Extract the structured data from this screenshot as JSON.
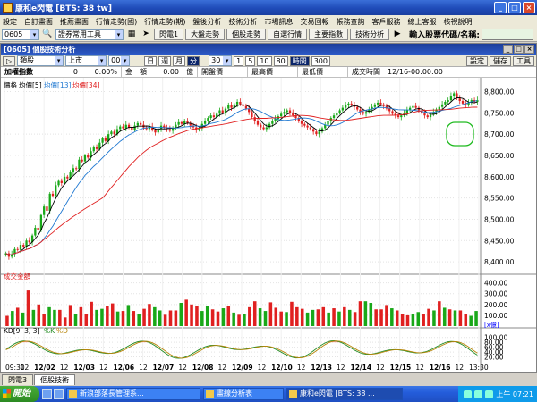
{
  "window": {
    "title": "康和e閃電 [BTS: 38 tw]",
    "buttons": [
      "_",
      "□",
      "×"
    ]
  },
  "menu": [
    "設定",
    "自訂畫面",
    "推薦畫面",
    "行情走勢(國)",
    "行情走勢(期)",
    "盤後分析",
    "技術分析",
    "市場訊息",
    "交易回報",
    "帳務查詢",
    "客戶服務",
    "線上客服",
    "核視說明"
  ],
  "toolbar": {
    "code_value": "0605",
    "tool_select": "證券常用工具",
    "buttons": [
      "閃電1",
      "大盤走勢",
      "個股走勢",
      "自選行情",
      "主要指數",
      "技術分析"
    ],
    "stock_label": "輸入股票代碼/名稱:"
  },
  "panel": {
    "title": "[0605] 個股技術分析",
    "controls": {
      "type": "類股",
      "market": "上市",
      "code": "001",
      "periods": [
        "日",
        "週",
        "月",
        "分"
      ],
      "minutes": "30",
      "ranges": [
        "1",
        "5",
        "10",
        "80",
        "時間",
        "300"
      ],
      "right_buttons": [
        "設定",
        "儲存",
        "工具"
      ]
    },
    "info": {
      "label": "加權指數",
      "price": "0",
      "change": "0.00%",
      "amount_label": "金　額",
      "amount": "0.00",
      "unit": "億",
      "open_label": "開盤價",
      "high_label": "最高價",
      "low_label": "最低價",
      "time_label": "成交時間",
      "time_value": "12/16-00:00:00"
    }
  },
  "price_legend": {
    "label": "價格",
    "ma5": "均價[5]",
    "ma13": "均價[13]",
    "ma34": "均價[34]"
  },
  "volume_legend": "成交金額",
  "volume_unit": "[x億]",
  "kd_legend": {
    "label": "KD[9, 3, 3]",
    "k": "%K",
    "d": "%D"
  },
  "tabs": [
    "閃電3",
    "個股技術"
  ],
  "taskbar": {
    "start": "開始",
    "items": [
      "新浪部落長管理系...",
      "畫線分析表",
      "康和e閃電 [BTS: 38 ..."
    ],
    "clock": "上午 07:21"
  },
  "colors": {
    "up": "#19a819",
    "down": "#e02020",
    "ma5": "#000000",
    "ma13": "#1f78d1",
    "ma34": "#e02020",
    "k": "#228b22",
    "d": "#b8860b"
  },
  "chart_data": [
    {
      "type": "candlestick",
      "name": "price",
      "y_ticks": [
        "8,800.00",
        "8,750.00",
        "8,700.00",
        "8,650.00",
        "8,600.00",
        "8,550.00",
        "8,500.00",
        "8,450.00",
        "8,400.00"
      ],
      "ylim": [
        8375,
        8820
      ],
      "x_ticks": [
        "09:30",
        "12",
        "12/02",
        "12",
        "12/03",
        "12",
        "12/06",
        "12",
        "12/07",
        "12",
        "12/08",
        "12",
        "12/09",
        "12",
        "12/10",
        "12",
        "12/13",
        "12",
        "12/14",
        "12",
        "12/15",
        "12",
        "12/16",
        "12",
        "13:30"
      ],
      "close": [
        8420,
        8412,
        8418,
        8430,
        8428,
        8440,
        8436,
        8450,
        8446,
        8462,
        8480,
        8474,
        8510,
        8530,
        8520,
        8560,
        8555,
        8580,
        8590,
        8585,
        8600,
        8596,
        8610,
        8620,
        8618,
        8640,
        8636,
        8650,
        8645,
        8660,
        8670,
        8665,
        8680,
        8690,
        8684,
        8700,
        8706,
        8700,
        8712,
        8718,
        8714,
        8722,
        8716,
        8710,
        8720,
        8726,
        8722,
        8716,
        8712,
        8718,
        8710,
        8704,
        8712,
        8720,
        8716,
        8712,
        8708,
        8715,
        8722,
        8728,
        8724,
        8730,
        8726,
        8720,
        8716,
        8710,
        8714,
        8724,
        8730,
        8738,
        8744,
        8740,
        8748,
        8756,
        8750,
        8760,
        8768,
        8762,
        8770,
        8776,
        8770,
        8766,
        8760,
        8752,
        8740,
        8730,
        8722,
        8716,
        8712,
        8716,
        8724,
        8730,
        8736,
        8742,
        8748,
        8752,
        8756,
        8750,
        8744,
        8738,
        8730,
        8724,
        8720,
        8716,
        8712,
        8706,
        8700,
        8706,
        8714,
        8722,
        8730,
        8738,
        8744,
        8750,
        8756,
        8762,
        8768,
        8772,
        8768,
        8764,
        8758,
        8752,
        8748,
        8752,
        8758,
        8764,
        8770,
        8774,
        8770,
        8766,
        8760,
        8754,
        8748,
        8744,
        8740,
        8744,
        8750,
        8756,
        8762,
        8766,
        8762,
        8756,
        8750,
        8744,
        8740,
        8746,
        8752,
        8758,
        8764,
        8770,
        8776,
        8780,
        8790,
        8796,
        8784,
        8778,
        8772,
        8768,
        8774,
        8780,
        8776,
        8780
      ],
      "ma5": true,
      "ma13": true,
      "ma34": true
    },
    {
      "type": "bar",
      "name": "volume",
      "y_ticks": [
        "400.00",
        "300.00",
        "200.00",
        "100.00"
      ],
      "ylim": [
        0,
        430
      ],
      "values": [
        95,
        140,
        170,
        125,
        330,
        150,
        200,
        115,
        175,
        150,
        150,
        80,
        195,
        115,
        175,
        110,
        225,
        150,
        160,
        190,
        210,
        135,
        140,
        195,
        140,
        115,
        160,
        205,
        175,
        145,
        105,
        145,
        145,
        215,
        245,
        200,
        185,
        140,
        190,
        155,
        135,
        165,
        185,
        125,
        105,
        110,
        175,
        230,
        165,
        140,
        220,
        170,
        135,
        130,
        225,
        175,
        160,
        125,
        150,
        155,
        175,
        125,
        165,
        135,
        175,
        150,
        130,
        230,
        230,
        215,
        155,
        155,
        195,
        165,
        145,
        115,
        100,
        115,
        130,
        110,
        160,
        145,
        230,
        170,
        155,
        145,
        145,
        110,
        95,
        140
      ]
    },
    {
      "type": "line",
      "name": "kd",
      "y_ticks": [
        "100.00",
        "80.00",
        "60.00",
        "40.00",
        "20.00"
      ],
      "ylim": [
        0,
        110
      ]
    }
  ]
}
